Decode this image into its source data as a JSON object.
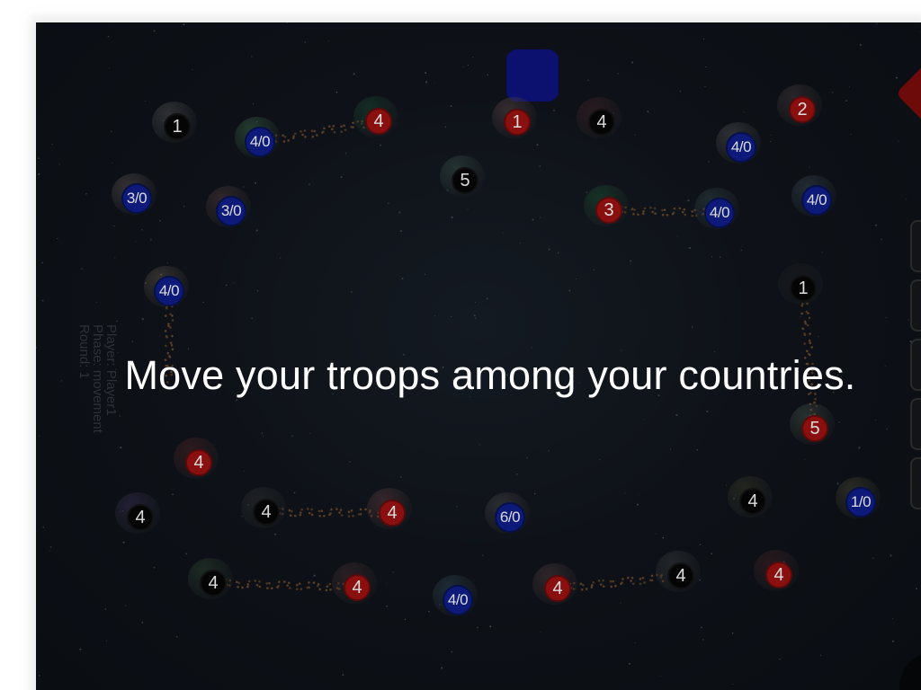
{
  "message": "Move your troops among your countries.",
  "status": {
    "player": "Player: Player1",
    "phase": "Phase: movement",
    "round": "Round: 1"
  },
  "colors": {
    "red": "#8a1010",
    "black": "#050505",
    "blue": "#0d1a7a",
    "top_button": "#0c1170",
    "corner_diamond": "#6d0b0b"
  },
  "territories": [
    {
      "label": "1",
      "owner": "black"
    },
    {
      "label": "4/0",
      "owner": "blue"
    },
    {
      "label": "4",
      "owner": "red"
    },
    {
      "label": "1",
      "owner": "red"
    },
    {
      "label": "4",
      "owner": "black"
    },
    {
      "label": "2",
      "owner": "red"
    },
    {
      "label": "4/0",
      "owner": "blue"
    },
    {
      "label": "5",
      "owner": "black"
    },
    {
      "label": "3/0",
      "owner": "blue"
    },
    {
      "label": "3/0",
      "owner": "blue"
    },
    {
      "label": "3",
      "owner": "red"
    },
    {
      "label": "4/0",
      "owner": "blue"
    },
    {
      "label": "4/0",
      "owner": "blue"
    },
    {
      "label": "4/0",
      "owner": "blue"
    },
    {
      "label": "1",
      "owner": "black"
    },
    {
      "label": "5",
      "owner": "red"
    },
    {
      "label": "4",
      "owner": "red"
    },
    {
      "label": "4",
      "owner": "black"
    },
    {
      "label": "4",
      "owner": "black"
    },
    {
      "label": "4",
      "owner": "red"
    },
    {
      "label": "6/0",
      "owner": "blue"
    },
    {
      "label": "4",
      "owner": "black"
    },
    {
      "label": "1/0",
      "owner": "blue"
    },
    {
      "label": "4",
      "owner": "black"
    },
    {
      "label": "4",
      "owner": "red"
    },
    {
      "label": "4/0",
      "owner": "blue"
    },
    {
      "label": "4",
      "owner": "red"
    },
    {
      "label": "4",
      "owner": "black"
    },
    {
      "label": "4",
      "owner": "red"
    }
  ]
}
